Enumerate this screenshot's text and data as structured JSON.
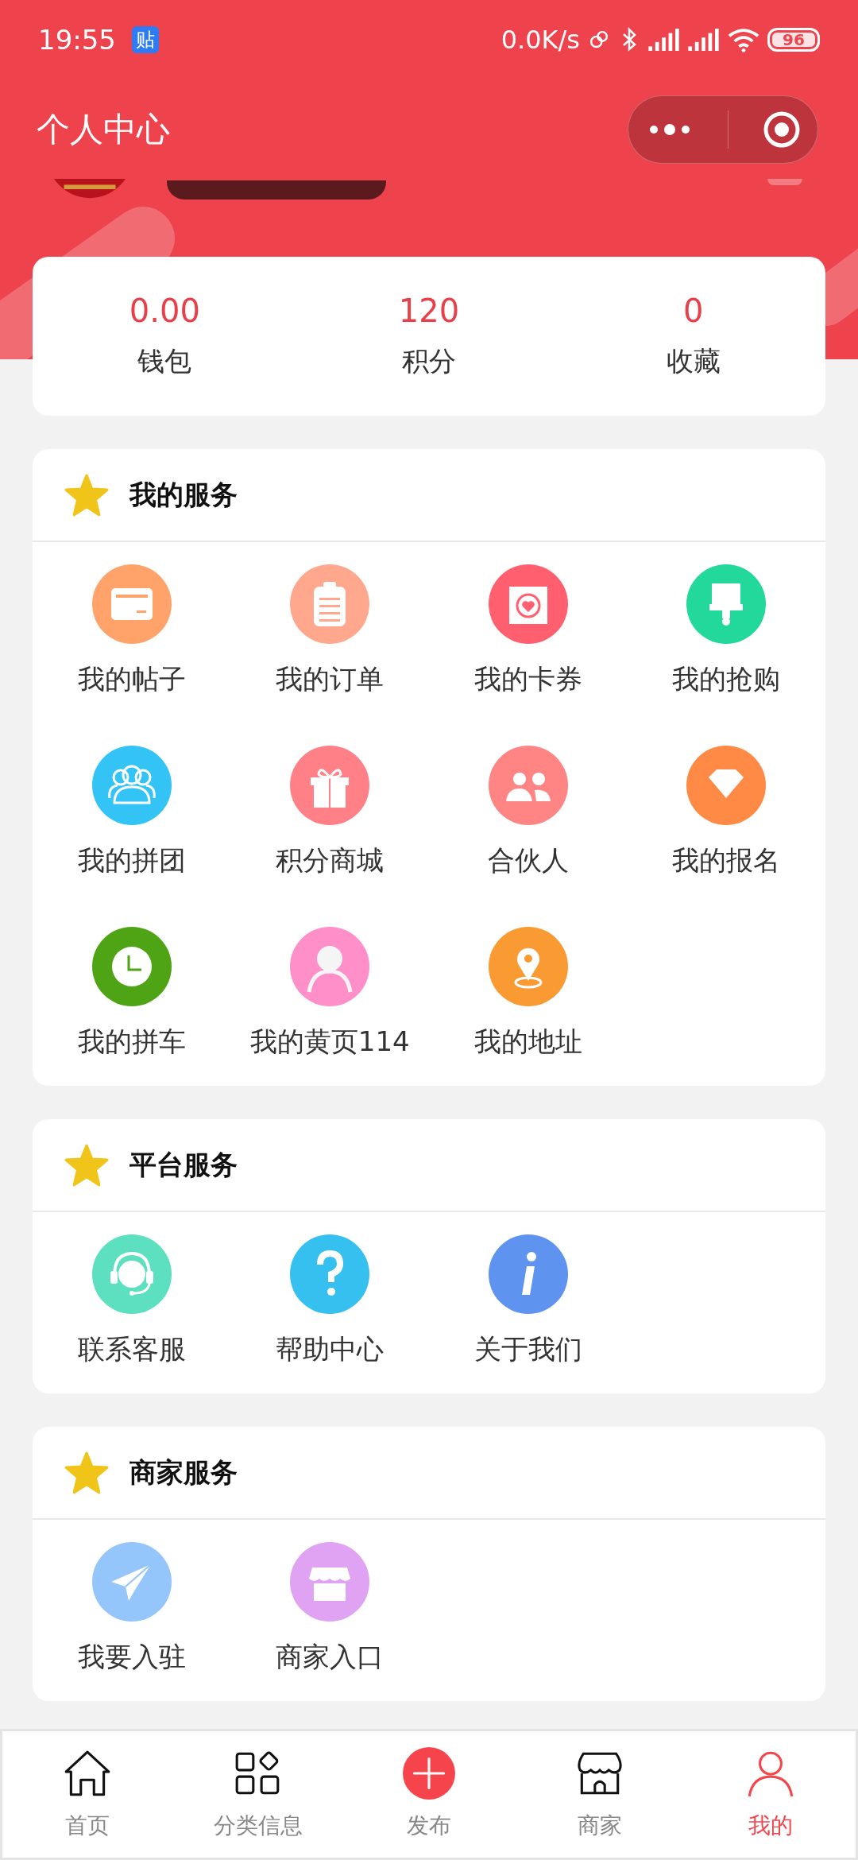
{
  "status_bar": {
    "time": "19:55",
    "app_badge": "贴",
    "speed": "0.0K/s",
    "battery": "96"
  },
  "header": {
    "title": "个人中心"
  },
  "stats": [
    {
      "value": "0.00",
      "label": "钱包"
    },
    {
      "value": "120",
      "label": "积分"
    },
    {
      "value": "0",
      "label": "收藏"
    }
  ],
  "sections": [
    {
      "title": "我的服务",
      "items": [
        {
          "label": "我的帖子",
          "kind": "card",
          "color": "#ffa36a"
        },
        {
          "label": "我的订单",
          "kind": "clipboard",
          "color": "#ffa88e"
        },
        {
          "label": "我的卡券",
          "kind": "camera",
          "color": "#ff5f6e"
        },
        {
          "label": "我的抢购",
          "kind": "brush",
          "color": "#22d89a"
        },
        {
          "label": "我的拼团",
          "kind": "group",
          "color": "#33c3f5"
        },
        {
          "label": "积分商城",
          "kind": "gift",
          "color": "#ff8086"
        },
        {
          "label": "合伙人",
          "kind": "partner",
          "color": "#ff8585"
        },
        {
          "label": "我的报名",
          "kind": "diamond",
          "color": "#ff8a45"
        },
        {
          "label": "我的拼车",
          "kind": "clock",
          "color": "#4ea414"
        },
        {
          "label": "我的黄页114",
          "kind": "person",
          "color": "#ff8fc8"
        },
        {
          "label": "我的地址",
          "kind": "pin",
          "color": "#fa9a32"
        }
      ]
    },
    {
      "title": "平台服务",
      "items": [
        {
          "label": "联系客服",
          "kind": "headset",
          "color": "#5ce0c0"
        },
        {
          "label": "帮助中心",
          "kind": "help",
          "color": "#35c0ef"
        },
        {
          "label": "关于我们",
          "kind": "info",
          "color": "#5f93f0"
        }
      ]
    },
    {
      "title": "商家服务",
      "items": [
        {
          "label": "我要入驻",
          "kind": "plane",
          "color": "#94c5fb"
        },
        {
          "label": "商家入口",
          "kind": "shop",
          "color": "#e0a2f2"
        }
      ]
    }
  ],
  "tab_bar": [
    {
      "label": "首页",
      "kind": "home",
      "selected": false
    },
    {
      "label": "分类信息",
      "kind": "category",
      "selected": false
    },
    {
      "label": "发布",
      "kind": "publish",
      "selected": false
    },
    {
      "label": "商家",
      "kind": "shop",
      "selected": false
    },
    {
      "label": "我的",
      "kind": "person",
      "selected": true
    }
  ]
}
